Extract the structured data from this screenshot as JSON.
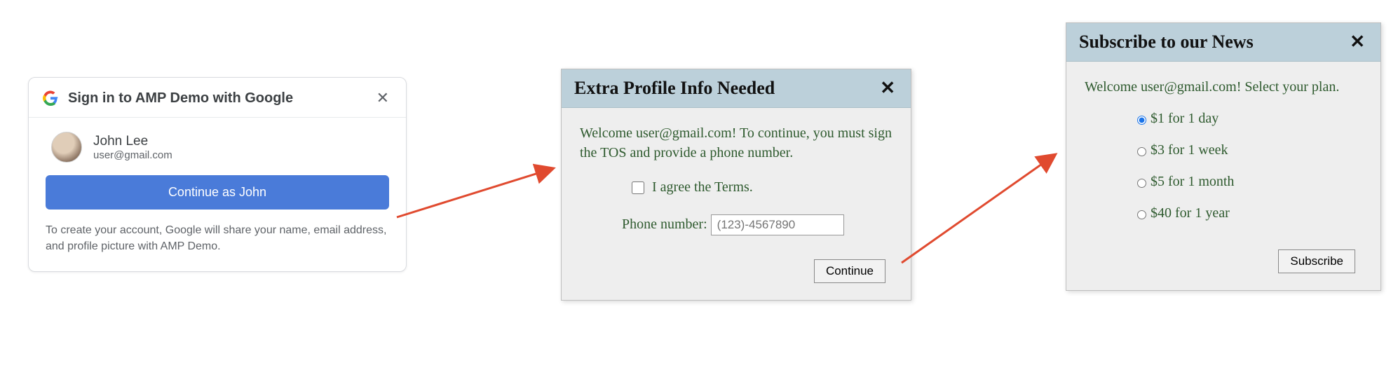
{
  "google_card": {
    "title": "Sign in to AMP Demo with Google",
    "close_glyph": "✕",
    "user_name": "John Lee",
    "user_email": "user@gmail.com",
    "continue_label": "Continue as John",
    "disclaimer": "To create your account, Google will share your name, email address, and profile picture with AMP Demo."
  },
  "profile_dialog": {
    "title": "Extra Profile Info Needed",
    "close_glyph": "✕",
    "welcome": "Welcome user@gmail.com! To continue, you must sign the TOS and provide a phone number.",
    "tos_label": "I agree the Terms.",
    "phone_label": "Phone number:",
    "phone_placeholder": "(123)-4567890",
    "continue_label": "Continue"
  },
  "subscribe_dialog": {
    "title": "Subscribe to our News",
    "close_glyph": "✕",
    "welcome": "Welcome user@gmail.com! Select your plan.",
    "plans": [
      {
        "label": "$1 for 1 day",
        "selected": true
      },
      {
        "label": "$3 for 1 week",
        "selected": false
      },
      {
        "label": "$5 for 1 month",
        "selected": false
      },
      {
        "label": "$40 for 1 year",
        "selected": false
      }
    ],
    "subscribe_label": "Subscribe"
  }
}
